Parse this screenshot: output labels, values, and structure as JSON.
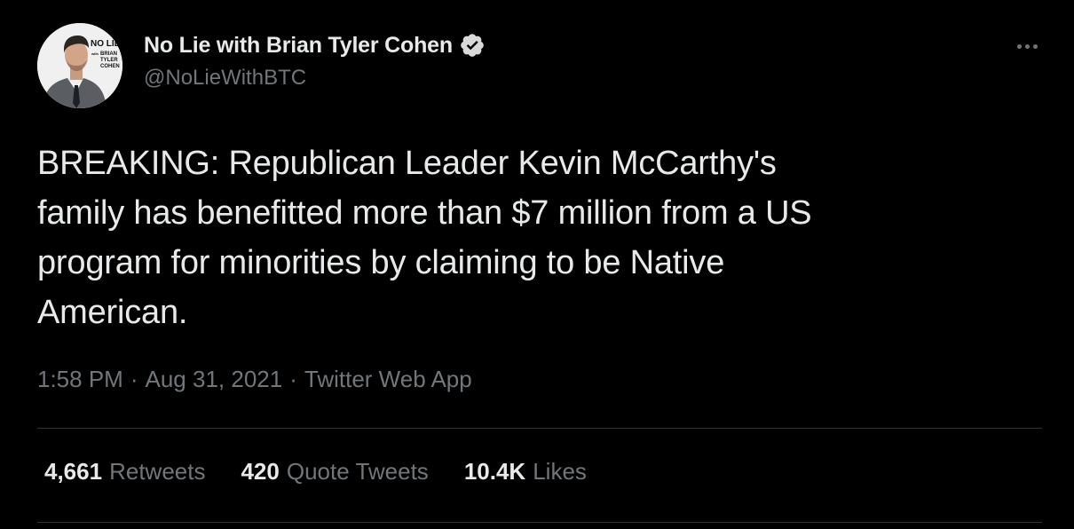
{
  "author": {
    "display_name": "No Lie with Brian Tyler Cohen",
    "handle": "@NoLieWithBTC",
    "verified": true,
    "avatar_logo_text": [
      "NO LIE",
      "with",
      "BRIAN",
      "TYLER",
      "COHEN"
    ]
  },
  "tweet": {
    "text": "BREAKING: Republican Leader Kevin McCarthy's\nfamily has benefitted more than $7 million from a US\nprogram for minorities by claiming to be Native\nAmerican."
  },
  "meta": {
    "time": "1:58 PM",
    "separator": "·",
    "date": "Aug 31, 2021",
    "source": "Twitter Web App"
  },
  "stats": {
    "retweets_count": "4,661",
    "retweets_label": "Retweets",
    "quotes_count": "420",
    "quotes_label": "Quote Tweets",
    "likes_count": "10.4K",
    "likes_label": "Likes"
  },
  "colors": {
    "background": "#000000",
    "primary_text": "#e7e9ea",
    "secondary_text": "#71767b",
    "divider": "#2f3336",
    "verified_badge": "#d9d9d9"
  },
  "icons": {
    "verified": "verified-badge-icon",
    "more": "more-options-icon"
  }
}
